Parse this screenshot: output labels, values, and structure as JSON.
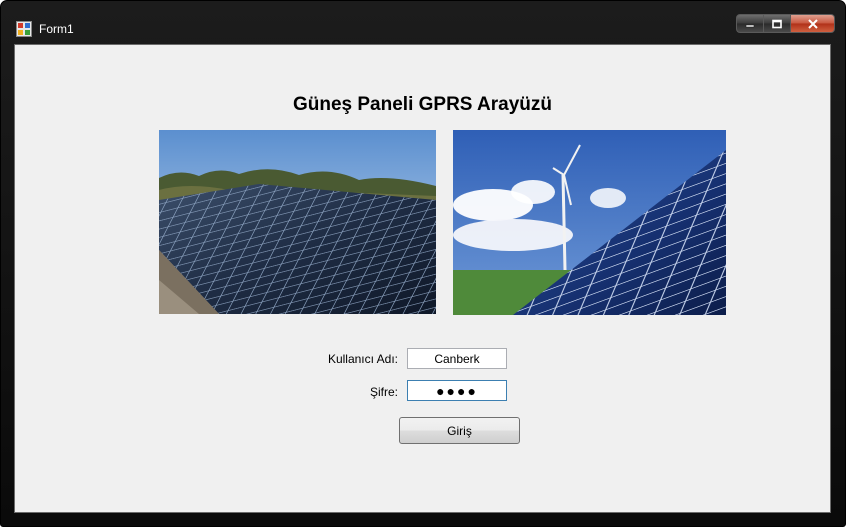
{
  "window": {
    "title": "Form1",
    "icon": "winforms-app-icon",
    "controls": [
      "minimize-icon",
      "maximize-icon",
      "close-icon"
    ]
  },
  "form": {
    "heading": "Güneş Paneli GPRS Arayüzü",
    "images": [
      {
        "depicts": "solar-panels-rooftop-photo"
      },
      {
        "depicts": "wind-turbine-solar-panel-photo"
      }
    ],
    "username_label": "Kullanıcı Adı:",
    "username_value": "Canberk",
    "password_label": "Şifre:",
    "password_value": "●●●●",
    "login_button": "Giriş"
  },
  "colors": {
    "client_bg": "#f0f0f0",
    "titlebar_bg": "#111111",
    "close_button": "#c8553d",
    "focus_border": "#3c7fb1"
  }
}
